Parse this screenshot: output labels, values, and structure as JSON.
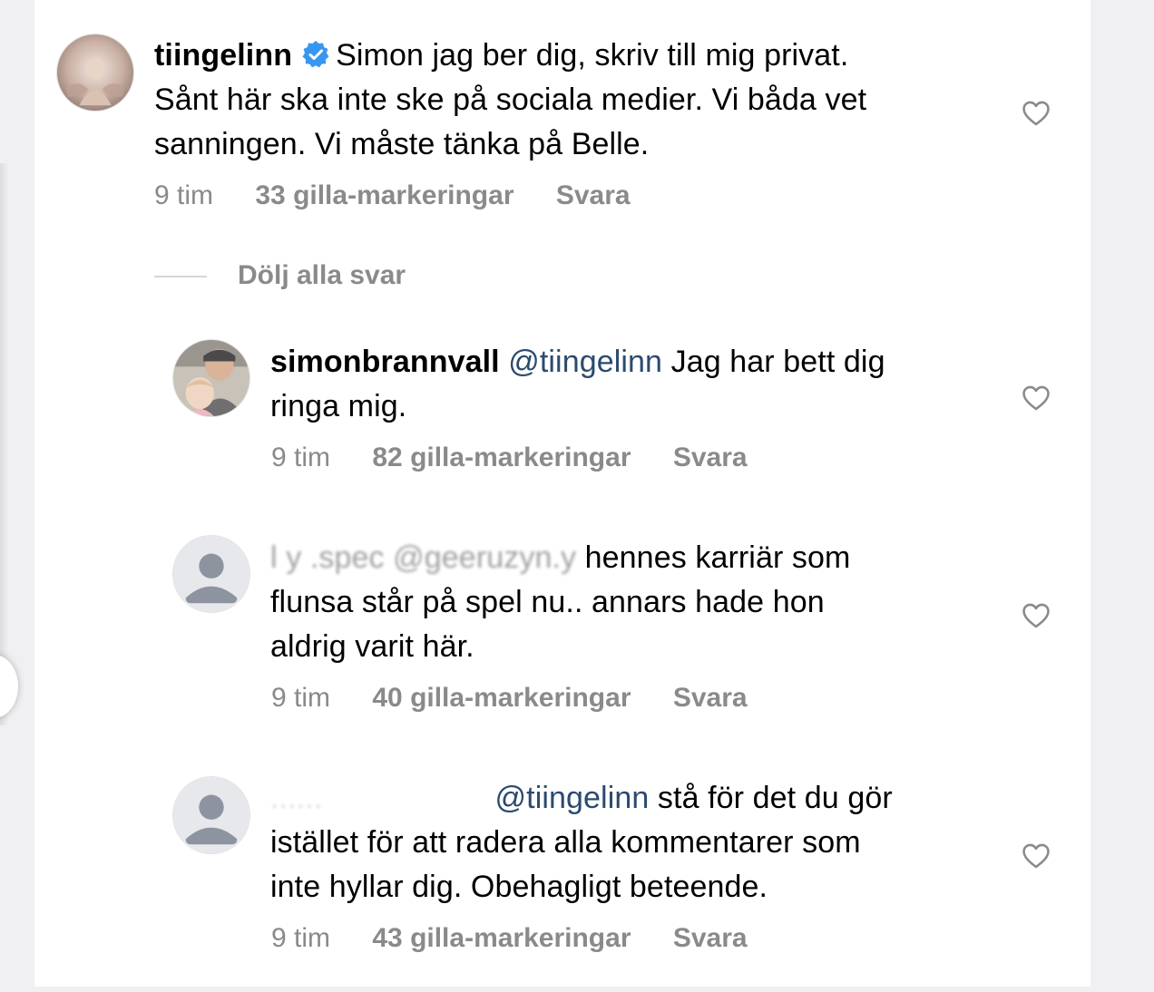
{
  "comments": [
    {
      "username": "tiingelinn",
      "verified": true,
      "mention": "",
      "text": "Simon jag ber dig, skriv till mig privat. Sånt här ska inte ske på sociala medier. Vi båda vet sanningen. Vi måste tänka på Belle.",
      "line1": "Simon jag ber dig, skriv till mig privat.",
      "line2": "Sånt här ska inte ske på sociala medier. Vi båda vet",
      "line3": "sanningen. Vi måste tänka på Belle.",
      "time": "9 tim",
      "likes": "33 gilla-markeringar",
      "reply": "Svara"
    },
    {
      "username": "simonbrannvall",
      "mention": "@tiingelinn",
      "line1": "Jag har bett dig",
      "line2": "ringa mig.",
      "time": "9 tim",
      "likes": "82 gilla-markeringar",
      "reply": "Svara"
    },
    {
      "username_redacted": "l  y  .spec",
      "mention_redacted": "@geeruzyn.y",
      "line1": "hennes karriär som",
      "line2": "flunsa står på spel nu.. annars hade hon",
      "line3": "aldrig varit här.",
      "time": "9 tim",
      "likes": "40 gilla-markeringar",
      "reply": "Svara"
    },
    {
      "username_redacted": "......",
      "mention": "@tiingelinn",
      "line1": "stå för det du gör",
      "line2": "istället för att radera alla kommentarer som",
      "line3": "inte hyllar dig. Obehagligt beteende.",
      "time": "9 tim",
      "likes": "43 gilla-markeringar",
      "reply": "Svara"
    }
  ],
  "replies_toggle": "Dölj alla svar",
  "colors": {
    "mention": "#2b4a6f",
    "meta": "#8a8a8a",
    "verified": "#3897f0"
  },
  "icons": [
    "heart-icon",
    "verified-badge-icon",
    "default-avatar-icon"
  ]
}
